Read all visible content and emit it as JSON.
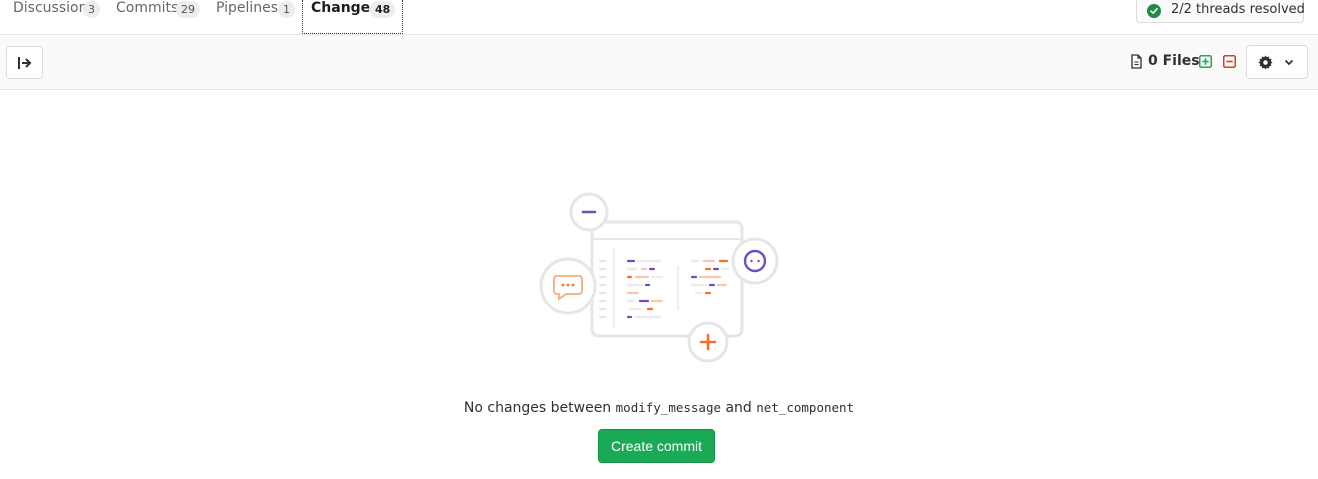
{
  "tabs": [
    {
      "label": "Discussion",
      "count": "3"
    },
    {
      "label": "Commits",
      "count": "29"
    },
    {
      "label": "Pipelines",
      "count": "1"
    },
    {
      "label": "Changes",
      "count": "48",
      "active": true
    }
  ],
  "threads": {
    "label": "2/2 threads resolved",
    "icon": "check-circle-icon",
    "color": "#1f8c45"
  },
  "toolbar": {
    "files_label": "0 Files",
    "add_color": "#1aaa55",
    "delete_color": "#db3b21"
  },
  "empty_state": {
    "prefix": "No changes between",
    "source_branch": "modify_message",
    "connector": "and",
    "target_branch": "net_component",
    "button_label": "Create commit",
    "button_color": "#1aaa55"
  }
}
